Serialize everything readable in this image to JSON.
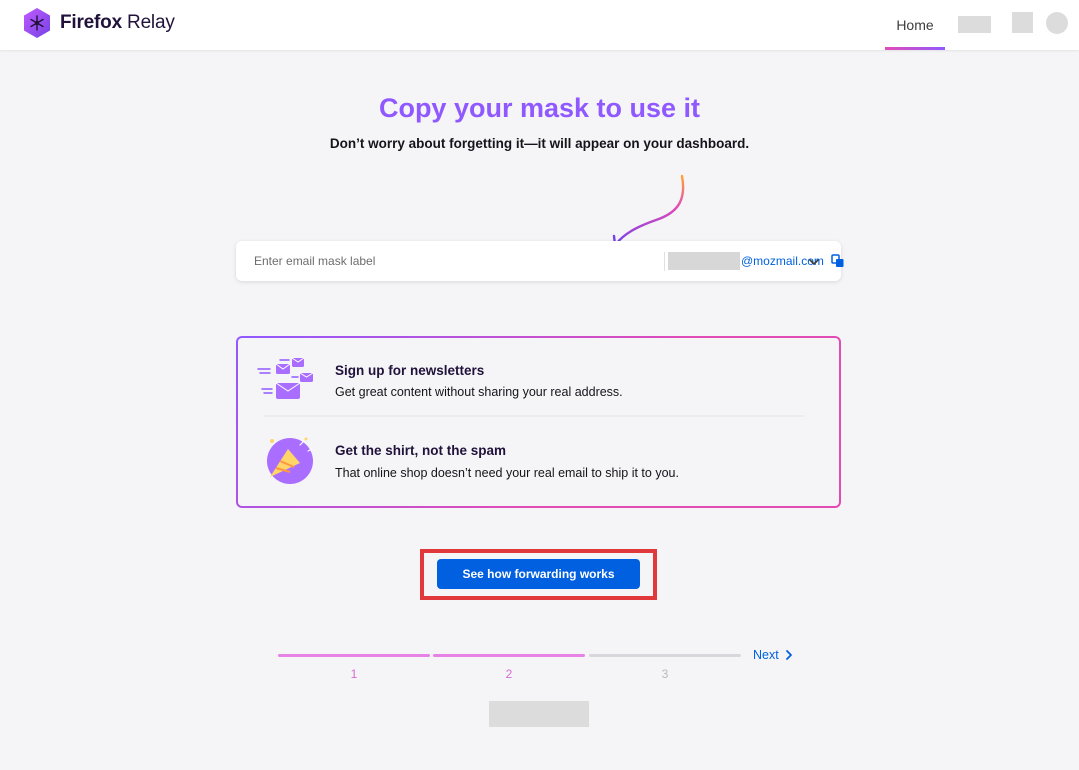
{
  "header": {
    "logo_text_bold": "Firefox",
    "logo_text": "Relay",
    "nav_home": "Home"
  },
  "main": {
    "title": "Copy your mask to use it",
    "subtitle": "Don’t worry about forgetting it—it will appear on your dashboard."
  },
  "mask": {
    "label_placeholder": "Enter email mask label",
    "domain": "@mozmail.com"
  },
  "tips": [
    {
      "title": "Sign up for newsletters",
      "body": "Get great content without sharing your real address."
    },
    {
      "title": "Get the shirt, not the spam",
      "body": "That online shop doesn’t need your real email to ship it to you."
    }
  ],
  "cta": {
    "label": "See how forwarding works"
  },
  "progress": {
    "steps": [
      "1",
      "2",
      "3"
    ],
    "current": 2,
    "next_label": "Next"
  },
  "colors": {
    "accent_purple": "#9059ff",
    "accent_pink": "#e24bb6",
    "link_blue": "#0060df",
    "highlight_red": "#e0383b"
  }
}
